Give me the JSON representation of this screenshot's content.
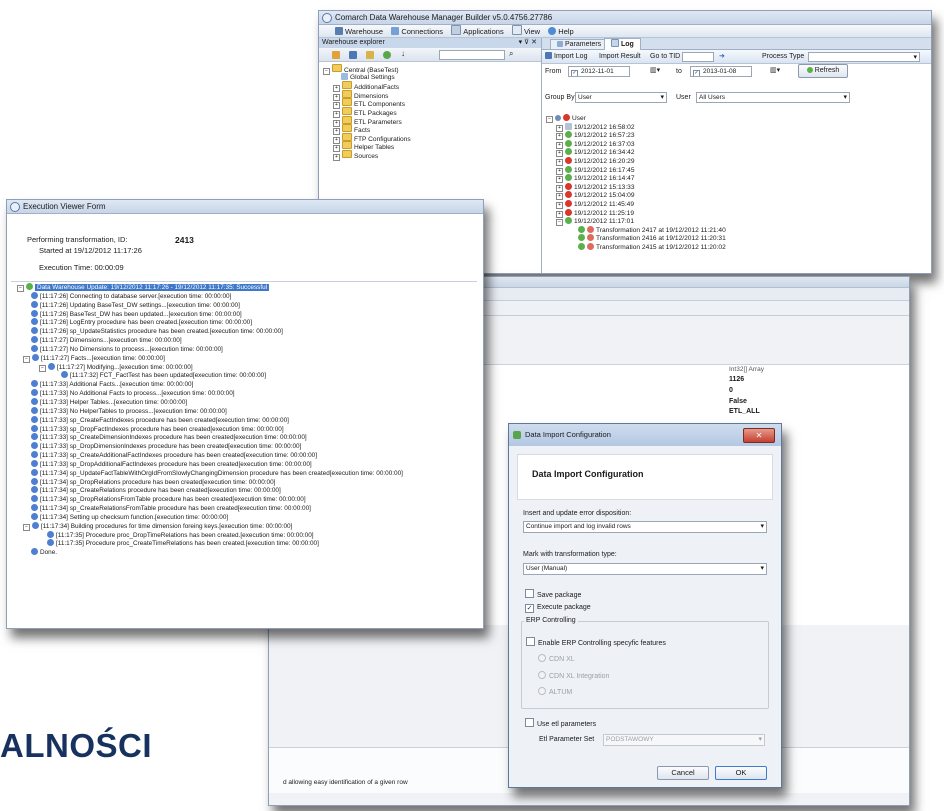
{
  "win1": {
    "title": "Comarch Data Warehouse Manager Builder v5.0.4756.27786",
    "menu": [
      "Warehouse",
      "Connections",
      "Applications",
      "View",
      "Help"
    ],
    "explorer_title": "Warehouse explorer",
    "explorer_pin": "▾ ⊽ ✕",
    "tree": [
      "Central (BaseTest)",
      "Global Settings",
      "AdditionalFacts",
      "Dimensions",
      "ETL Components",
      "ETL Packages",
      "ETL Parameters",
      "Facts",
      "FTP Configurations",
      "Helper Tables",
      "Sources"
    ],
    "tabs": [
      "Parameters",
      "Log"
    ],
    "toolbar": {
      "import_log": "Import Log",
      "import_result": "Import Result",
      "go_to_tid": "Go to TID",
      "process_type": "Process Type"
    },
    "from_label": "From",
    "from_value": "2012-11-01",
    "to_label": "to",
    "to_value": "2013-01-08",
    "refresh": "Refresh",
    "group_label": "Group By",
    "group_value": "User",
    "user_label": "User",
    "user_value": "All Users",
    "log_root": "User",
    "log_entries": [
      "19/12/2012 16:58:02",
      "19/12/2012 16:57:23",
      "19/12/2012 16:37:03",
      "19/12/2012 16:34:42",
      "19/12/2012 16:20:29",
      "19/12/2012 16:17:45",
      "19/12/2012 16:14:47",
      "19/12/2012 15:13:33",
      "19/12/2012 15:04:09",
      "19/12/2012 11:45:49",
      "19/12/2012 11:25:19",
      "19/12/2012 11:17:01"
    ],
    "transformations": [
      "Transformation 2417 at 19/12/2012 11:21:40",
      "Transformation 2416 at 19/12/2012 11:20:31",
      "Transformation 2415 at 19/12/2012 11:20:02"
    ]
  },
  "win2": {
    "title": "Execution Viewer Form",
    "perf_label": "Performing transformation, ID:",
    "perf_id": "2413",
    "started": "Started at 19/12/2012 11:17:26",
    "exec_time": "Execution Time: 00:00:09",
    "log_header": "Data Warehouse Update: 19/12/2012 11:17:26 - 19/12/2012 11:17:35: Successful",
    "log_lines": [
      "[11:17:26] Connecting to database server.[execution time: 00:00:00]",
      "[11:17:26] Updating BaseTest_DW settings...[execution time: 00:00:00]",
      "[11:17:26] BaseTest_DW has been updated...[execution time: 00:00:00]",
      "[11:17:26] LogEntry procedure has been created.[execution time: 00:00:00]",
      "[11:17:26] sp_UpdateStatistics procedure has been created.[execution time: 00:00:00]",
      "[11:17:27] Dimensions...[execution time: 00:00:00]",
      "[11:17:27] No Dimensions to process...[execution time: 00:00:00]",
      "[11:17:27] Facts...[execution time: 00:00:00]",
      "[11:17:27] Modifying...[execution time: 00:00:00]",
      "[11:17:32] FCT_FactTest has been updated[execution time: 00:00:00]",
      "[11:17:33] Additional Facts...[execution time: 00:00:00]",
      "[11:17:33] No Additional Facts to process...[execution time: 00:00:00]",
      "[11:17:33] Helper Tables...[execution time: 00:00:00]",
      "[11:17:33] No HelperTables to process...[execution time: 00:00:00]",
      "[11:17:33] sp_CreateFactIndexes procedure has been created[execution time: 00:00:00]",
      "[11:17:33] sp_DropFactIndexes procedure has been created[execution time: 00:00:00]",
      "[11:17:33] sp_CreateDimensionIndexes procedure has been created[execution time: 00:00:00]",
      "[11:17:33] sp_DropDimensionIndexes procedure has been created[execution time: 00:00:00]",
      "[11:17:33] sp_CreateAdditionalFactIndexes procedure has been created[execution time: 00:00:00]",
      "[11:17:33] sp_DropAdditionalFactIndexes procedure has been created[execution time: 00:00:00]",
      "[11:17:34] sp_UpdateFactTableWithOrgIdFromSlowlyChangingDimension procedure has been created[execution time: 00:00:00]",
      "[11:17:34] sp_DropRelations procedure has been created[execution time: 00:00:00]",
      "[11:17:34] sp_CreateRelations procedure has been created[execution time: 00:00:00]",
      "[11:17:34] sp_DropRelationsFromTable procedure has been created[execution time: 00:00:00]",
      "[11:17:34] sp_CreateRelationsFromTable procedure has been created[execution time: 00:00:00]",
      "[11:17:34] Setting up checksum function.[execution time: 00:00:00]",
      "[11:17:34] Building procedures for time dimension foreing keys.[execution time: 00:00:00]",
      "[11:17:35] Procedure proc_DropTimeRelations has been created.[execution time: 00:00:00]",
      "[11:17:35] Procedure proc_CreateTimeRelations has been created.[execution time: 00:00:00]",
      "Done."
    ]
  },
  "win3": {
    "type_label": "Int32[] Array",
    "values": [
      "1126",
      "0",
      "False",
      "ETL_ALL"
    ],
    "footer_text": "d allowing easy identification of a given row"
  },
  "dialog": {
    "title": "Data Import Configuration",
    "header": "Data Import Configuration",
    "error_label": "Insert and update error disposition:",
    "error_value": "Continue import and log invalid rows",
    "mark_label": "Mark with transformation type:",
    "mark_value": "User (Manual)",
    "save_package": "Save package",
    "execute_package": "Execute package",
    "erp_group": "ERP Controlling",
    "erp_enable": "Enable ERP Controlling specyfic features",
    "radios": [
      "CDN XL",
      "CDN XL Integration",
      "ALTUM"
    ],
    "use_etl": "Use etl parameters",
    "etl_set_label": "Etl Parameter Set",
    "etl_set_value": "PODSTAWOWY",
    "cancel": "Cancel",
    "ok": "OK",
    "close_glyph": "✕"
  },
  "bg_text": "ALNOŚCI"
}
